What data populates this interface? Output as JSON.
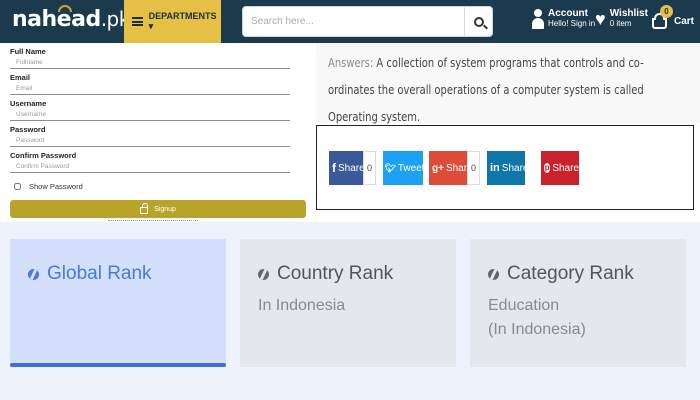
{
  "header": {
    "logo": {
      "prefix": "nahe",
      "middle": "ad",
      "suffix": ".pk"
    },
    "departments_label": "DEPARTMENTS ▾",
    "search_placeholder": "Search here...",
    "account": {
      "title": "Account",
      "subtitle": "Hello! Sign in"
    },
    "wishlist": {
      "title": "Wishlist",
      "subtitle": "0 item"
    },
    "cart": {
      "title": "Cart",
      "badge": "0"
    },
    "brand_color": "#1b3a4d",
    "accent_color": "#e6c046"
  },
  "form": {
    "fields": [
      {
        "label": "Full Name",
        "placeholder": "Fullname"
      },
      {
        "label": "Email",
        "placeholder": "Email"
      },
      {
        "label": "Username",
        "placeholder": "Username"
      },
      {
        "label": "Password",
        "placeholder": "Password"
      },
      {
        "label": "Confirm Password",
        "placeholder": "Confirm Password"
      }
    ],
    "show_password": "Show Password",
    "signup_label": "Signup"
  },
  "answer": {
    "label": "Answers:",
    "text": "A collection of system programs that controls and co-ordinates the overall operations of a computer system is called Operating system."
  },
  "share": {
    "facebook": {
      "label": "Share",
      "count": "0",
      "icon": "f",
      "color": "#3b5998"
    },
    "twitter": {
      "label": "Tweet",
      "icon": "twitter-bird",
      "color": "#1da1f2"
    },
    "google": {
      "label": "Share",
      "count": "0",
      "icon": "g+",
      "color": "#dd4b39"
    },
    "linkedin": {
      "label": "Share",
      "icon": "in",
      "color": "#0e76a8"
    },
    "pinterest": {
      "label": "Share",
      "icon": "p",
      "color": "#c8232c"
    }
  },
  "ranks": [
    {
      "title": "Global Rank",
      "sub1": "",
      "sub2": ""
    },
    {
      "title": "Country Rank",
      "sub1": "In Indonesia",
      "sub2": ""
    },
    {
      "title": "Category Rank",
      "sub1": "Education",
      "sub2": "(In Indonesia)"
    }
  ],
  "active_color": "#3d6fd8"
}
